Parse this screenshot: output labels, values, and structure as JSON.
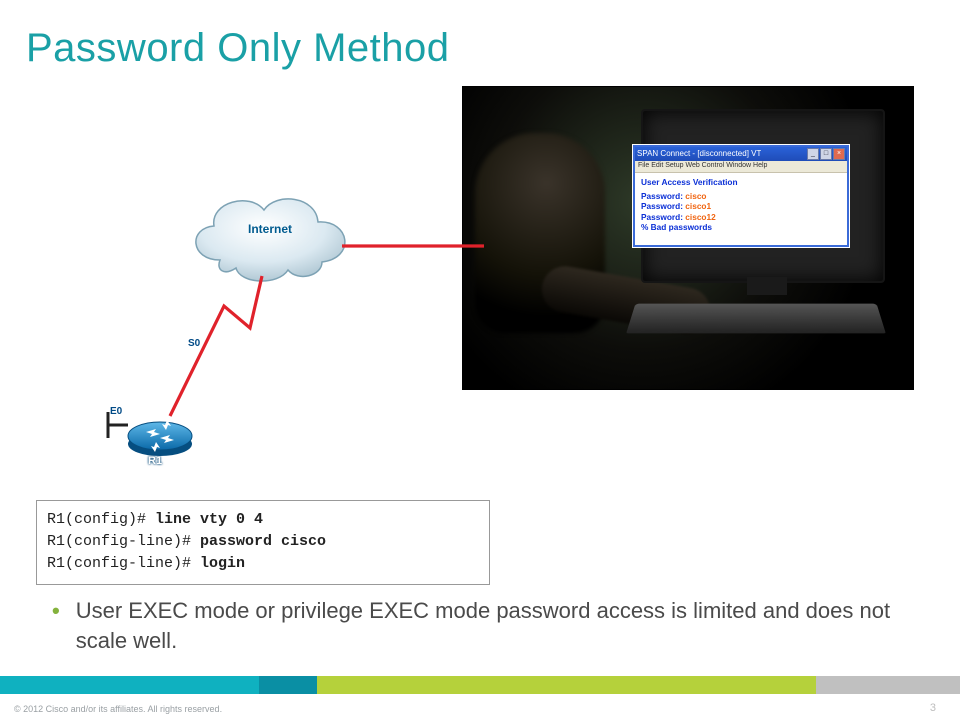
{
  "slide": {
    "title": "Password Only Method",
    "page_number": "3",
    "copyright": "© 2012 Cisco and/or its affiliates. All rights reserved."
  },
  "diagram": {
    "cloud_label": "Internet",
    "interface_s0": "S0",
    "interface_e0": "E0",
    "router_label": "R1"
  },
  "terminal": {
    "title": "SPAN Connect - [disconnected] VT",
    "menu": "File  Edit  Setup  Web  Control  Window  Help",
    "verify": "User Access Verification",
    "lines": [
      {
        "prompt": "Password:",
        "value": "cisco"
      },
      {
        "prompt": "Password:",
        "value": "cisco1"
      },
      {
        "prompt": "Password:",
        "value": "cisco12"
      }
    ],
    "bad": "% Bad passwords"
  },
  "code": {
    "l1_prompt": "R1(config)# ",
    "l1_cmd": "line vty 0 4",
    "l2_prompt": "R1(config-line)# ",
    "l2_cmd": "password cisco",
    "l3_prompt": "R1(config-line)# ",
    "l3_cmd": "login"
  },
  "bullet": {
    "text": "User EXEC mode or privilege EXEC mode password access is limited and does not scale well."
  },
  "colors": {
    "accent_teal": "#1aa0a6",
    "accent_green": "#b5d13b",
    "link_red": "#e0222b"
  }
}
